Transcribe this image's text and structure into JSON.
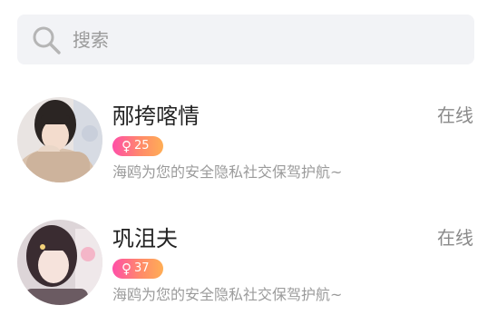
{
  "search": {
    "placeholder": "搜索",
    "value": ""
  },
  "users": [
    {
      "name": "邴挎喀情",
      "status": "在线",
      "gender_icon": "female-icon",
      "gender_symbol": "♀",
      "age": "25",
      "bio": "海鸥为您的安全隐私社交保驾护航~"
    },
    {
      "name": "巩沮夫",
      "status": "在线",
      "gender_icon": "female-icon",
      "gender_symbol": "♀",
      "age": "37",
      "bio": "海鸥为您的安全隐私社交保驾护航~"
    }
  ],
  "colors": {
    "search_bg": "#f2f3f6",
    "badge_gradient_start": "#ff4fa8",
    "badge_gradient_end": "#ffae55",
    "status_text": "#8a8a8a",
    "bio_text": "#9b9b9b"
  }
}
